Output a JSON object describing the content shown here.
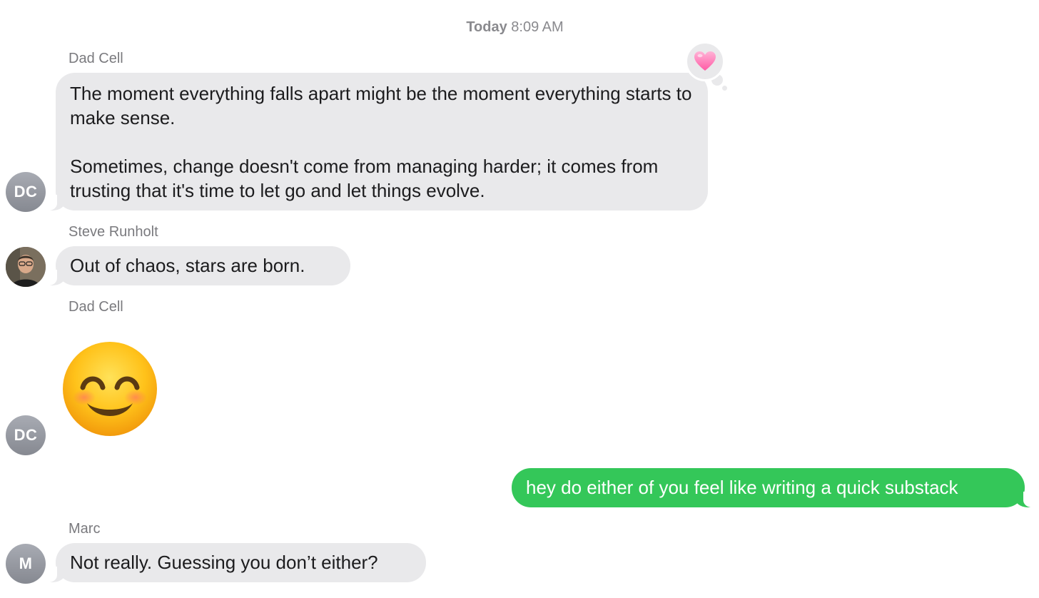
{
  "header": {
    "day": "Today",
    "time": "8:09 AM"
  },
  "messages": [
    {
      "sender": "Dad Cell",
      "avatar_initials": "DC",
      "paragraphs": [
        "The moment everything falls apart might be the moment everything starts to make sense.",
        "Sometimes, change doesn't come from managing harder; it comes from trusting that it's time to let go and let things evolve."
      ],
      "reaction": "heart-reaction"
    },
    {
      "sender": "Steve Runholt",
      "avatar": "photo",
      "text": "Out of chaos, stars are born."
    },
    {
      "sender": "Dad Cell",
      "avatar_initials": "DC",
      "emoji": "smiling-face-with-smiling-eyes"
    },
    {
      "sender": "me",
      "text": "hey do either of you feel like writing a quick substack"
    },
    {
      "sender": "Marc",
      "avatar_initials": "M",
      "text": "Not really. Guessing you don’t either?"
    }
  ],
  "colors": {
    "received_bubble": "#e9e9eb",
    "sent_bubble": "#34c759",
    "reaction_heart": "#ff7eb6"
  }
}
